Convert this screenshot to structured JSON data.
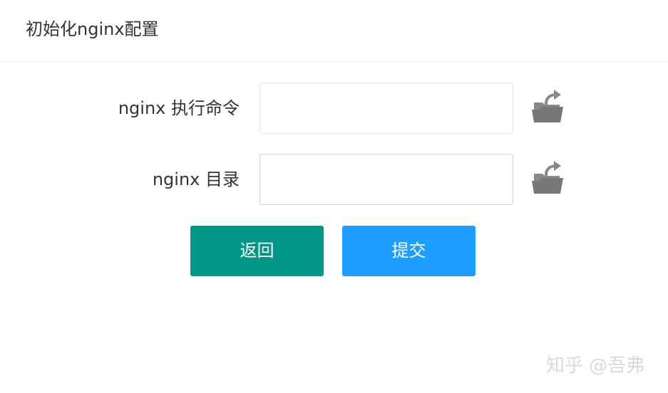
{
  "header": {
    "title": "初始化nginx配置"
  },
  "form": {
    "nginx_command": {
      "label": "nginx 执行命令",
      "value": "",
      "icon": "folder-open-icon"
    },
    "nginx_dir": {
      "label": "nginx 目录",
      "value": "",
      "icon": "folder-open-icon"
    }
  },
  "buttons": {
    "back_label": "返回",
    "submit_label": "提交"
  },
  "colors": {
    "back": "#009688",
    "submit": "#1e9fff",
    "icon": "#888888"
  },
  "watermark": {
    "text": "知乎 @吾弗"
  }
}
